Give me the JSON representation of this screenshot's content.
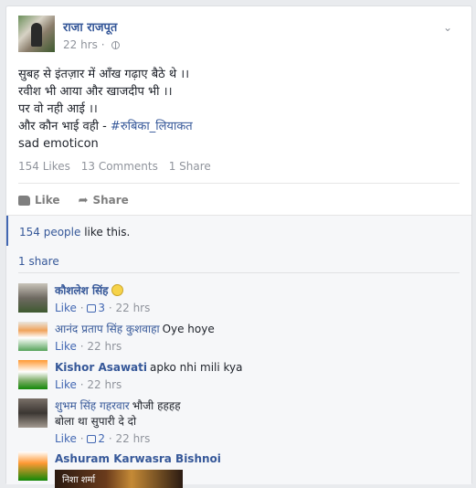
{
  "post": {
    "author": "राजा राजपूत",
    "time": "22 hrs",
    "lines": [
      "सुबह से इंतज़ार में आँख गढ़ाए बैठे थे ।।",
      "रवीश भी आया और खाजदीप भी ।।",
      "पर वो नही आई ।।",
      "और कौन भाई वही - "
    ],
    "hashtag": "#रुबिका_लियाकत",
    "last_line": "sad emoticon",
    "stats": {
      "likes": "154 Likes",
      "comments": "13 Comments",
      "shares": "1 Share"
    },
    "actions": {
      "like": "Like",
      "share": "Share"
    }
  },
  "ufi": {
    "likes_link": "154 people",
    "likes_suffix": " like this.",
    "shares": "1 share"
  },
  "comments": [
    {
      "name": "कौशलेश सिंह",
      "text": "",
      "like": "Like",
      "count": "3",
      "time": "22 hrs"
    },
    {
      "name": "आनंद प्रताप सिंह कुशवाहा",
      "text": "Oye hoye",
      "like": "Like",
      "count": "",
      "time": "22 hrs"
    },
    {
      "name": "Kishor Asawati",
      "text": "apko nhi mili kya",
      "like": "Like",
      "count": "",
      "time": "22 hrs"
    },
    {
      "name": "शुभम सिंह गहरवार",
      "text": "भौजी हहहह",
      "text2": "बोला था सुपारी दे दो",
      "like": "Like",
      "count": "2",
      "time": "22 hrs"
    },
    {
      "name": "Ashuram Karwasra Bishnoi",
      "embed": "निशा शर्मा"
    }
  ],
  "icons": {
    "chevron": "chevron-down-icon",
    "globe": "globe-icon",
    "like": "thumbs-up-icon",
    "share": "share-arrow-icon",
    "emoji": "smile-emoji-icon"
  },
  "colors": {
    "link": "#365899",
    "accent": "#4267b2",
    "muted": "#90949c"
  }
}
